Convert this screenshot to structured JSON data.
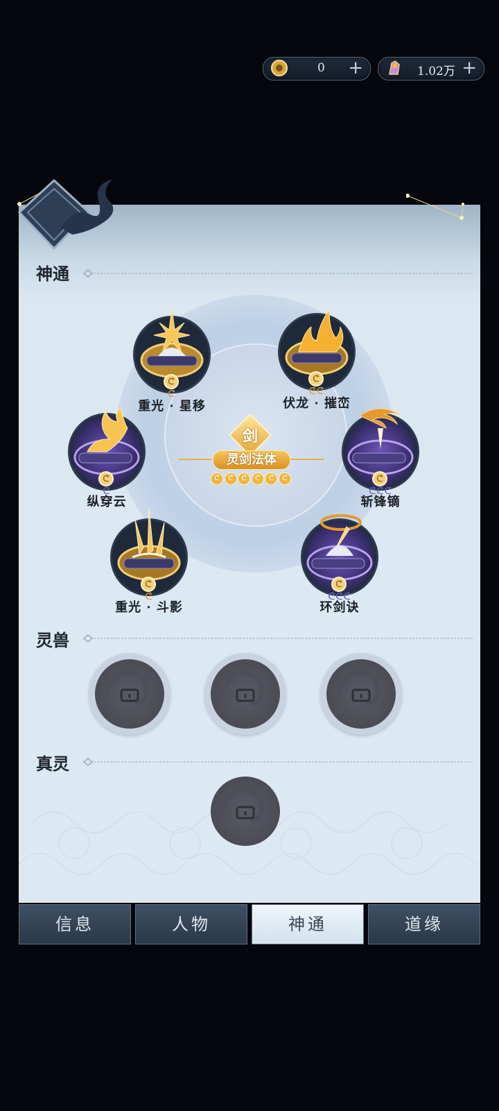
{
  "currencies": [
    {
      "icon": "gold-coin-icon",
      "value": "0"
    },
    {
      "icon": "spirit-stone-icon",
      "value": "1.02万"
    }
  ],
  "sections": {
    "shentong": "神通",
    "lingshou": "灵兽",
    "zhenling": "真灵"
  },
  "emblem": {
    "char": "剑",
    "title": "灵剑法体",
    "level_dots": 6
  },
  "skills": [
    {
      "name": "重光 · 星移",
      "style": "dark",
      "tokens": "ᕦ"
    },
    {
      "name": "伏龙 · 摧峦",
      "style": "dark",
      "tokens": "ᕦᕦ"
    },
    {
      "name": "纵穿云",
      "style": "purple",
      "tokens": "ᕦ"
    },
    {
      "name": "斩锋镝",
      "style": "purple",
      "tokens": "ᕦᕦᕦ"
    },
    {
      "name": "重光 · 斗影",
      "style": "dark",
      "tokens": "ᕦ"
    },
    {
      "name": "环剑诀",
      "style": "purple",
      "tokens": "ᕦᕦᕦ"
    }
  ],
  "tabs": [
    {
      "label": "信息",
      "active": false
    },
    {
      "label": "人物",
      "active": false
    },
    {
      "label": "神通",
      "active": true
    },
    {
      "label": "道缘",
      "active": false
    }
  ],
  "colors": {
    "gold": "#e2a63a",
    "purple_token": "#6a58b8",
    "gold_token": "#d89a2a"
  }
}
